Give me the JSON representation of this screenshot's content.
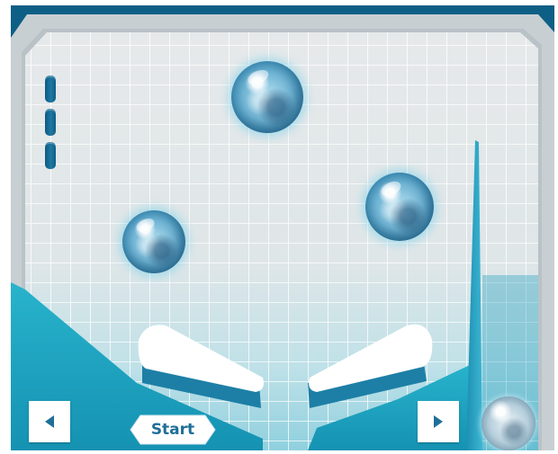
{
  "game": {
    "start_label": "Start",
    "balls_remaining": 3,
    "controls": {
      "left_flipper": "left-arrow-icon",
      "right_flipper": "right-arrow-icon"
    }
  },
  "colors": {
    "frame": "#0e5f86",
    "teal": "#1aa3c0",
    "grid_line": "#ffffff",
    "button_text": "#1f6f98"
  }
}
